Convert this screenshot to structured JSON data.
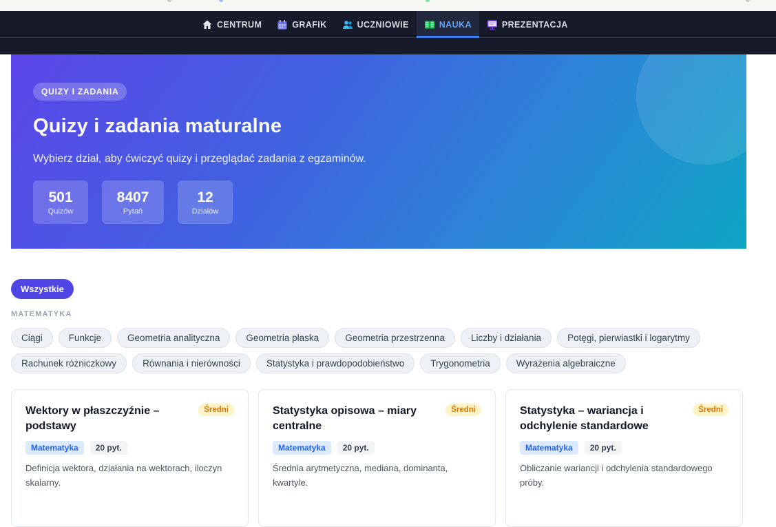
{
  "nav": {
    "items": [
      {
        "label": "CENTRUM",
        "icon": "home-icon"
      },
      {
        "label": "GRAFIK",
        "icon": "calendar-icon"
      },
      {
        "label": "UCZNIOWIE",
        "icon": "users-icon"
      },
      {
        "label": "NAUKA",
        "icon": "book-icon",
        "active": true
      },
      {
        "label": "PREZENTACJA",
        "icon": "presentation-icon"
      }
    ]
  },
  "hero": {
    "badge": "QUIZY I ZADANIA",
    "title": "Quizy i zadania maturalne",
    "subtitle": "Wybierz dział, aby ćwiczyć quizy i przeglądać zadania z egzaminów.",
    "stats": [
      {
        "value": "501",
        "label": "Quizów"
      },
      {
        "value": "8407",
        "label": "Pytań"
      },
      {
        "value": "12",
        "label": "Działów"
      }
    ]
  },
  "filters": {
    "all_label": "Wszystkie",
    "section_label": "MATEMATYKA",
    "row1": [
      "Ciągi",
      "Funkcje",
      "Geometria analityczna",
      "Geometria płaska",
      "Geometria przestrzenna",
      "Liczby i działania",
      "Potęgi, pierwiastki i logarytmy"
    ],
    "row2": [
      "Rachunek różniczkowy",
      "Równania i nierówności",
      "Statystyka i prawdopodobieństwo",
      "Trygonometria",
      "Wyrażenia algebraiczne"
    ]
  },
  "cards": [
    {
      "title": "Wektory w płaszczyźnie – podstawy",
      "level": "Średni",
      "subject": "Matematyka",
      "count": "20 pyt.",
      "description": "Definicja wektora, działania na wektorach, iloczyn skalarny."
    },
    {
      "title": "Statystyka opisowa – miary centralne",
      "level": "Średni",
      "subject": "Matematyka",
      "count": "20 pyt.",
      "description": "Średnia arytmetyczna, mediana, dominanta, kwartyle."
    },
    {
      "title": "Statystyka – wariancja i odchylenie standardowe",
      "level": "Średni",
      "subject": "Matematyka",
      "count": "20 pyt.",
      "description": "Obliczanie wariancji i odchylenia standardowego próby."
    }
  ],
  "colors": {
    "nav_bg": "#171a28",
    "accent": "#4f46e5",
    "active_nav": "#60a5fa",
    "level_badge": "#d97706"
  }
}
